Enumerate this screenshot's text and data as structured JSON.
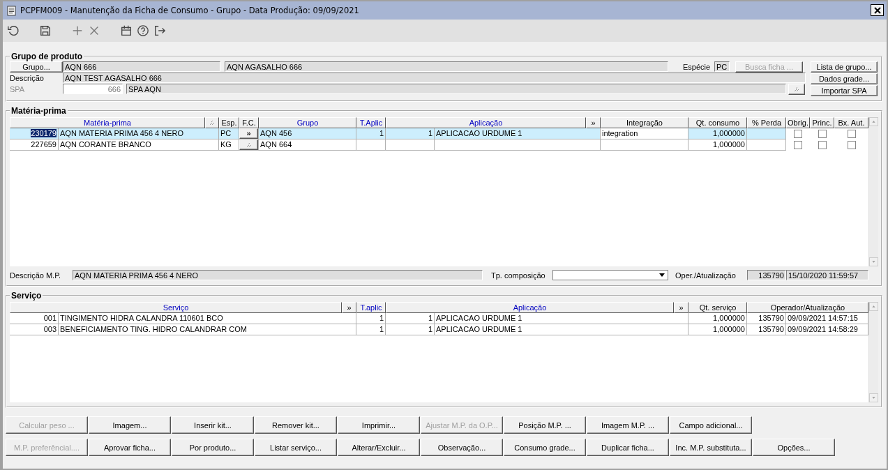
{
  "window": {
    "title": "PCPFM009 - Manutenção da Ficha de Consumo - Grupo - Data Produção: 09/09/2021"
  },
  "product_group": {
    "title": "Grupo de produto",
    "group_button": "Grupo...",
    "group_code": "AQN 666",
    "group_name": "AQN AGASALHO 666",
    "species_label": "Espécie",
    "species": "PC",
    "search_button": {
      "label": "Busca ficha ...",
      "disabled": true
    },
    "description_label": "Descrição",
    "description": "AQN TEST AGASALHO 666",
    "spa_label": {
      "label": "SPA",
      "disabled": true
    },
    "spa_code": "666",
    "spa_name": "SPA AQN",
    "buttons": [
      "Lista de grupo...",
      "Dados grade...",
      "Importar SPA"
    ]
  },
  "raw_materials": {
    "title": "Matéria-prima",
    "headers": [
      {
        "kind": "text",
        "label": "Matéria-prima",
        "linked": true
      },
      {
        "kind": "icon"
      },
      {
        "kind": "text",
        "label": "Esp.",
        "linked": false
      },
      {
        "kind": "text",
        "label": "F.C.",
        "linked": false
      },
      {
        "kind": "text",
        "label": "Grupo",
        "linked": true
      },
      {
        "kind": "text",
        "label": "T.Aplic",
        "linked": true
      },
      {
        "kind": "text",
        "label": "Aplicação",
        "linked": true
      },
      {
        "kind": "text",
        "label": "»",
        "linked": false
      },
      {
        "kind": "text",
        "label": "Integração",
        "linked": false
      },
      {
        "kind": "text",
        "label": "Qt. consumo",
        "linked": false
      },
      {
        "kind": "text",
        "label": "% Perda",
        "linked": false
      },
      {
        "kind": "text",
        "label": "Obrig.",
        "linked": false
      },
      {
        "kind": "text",
        "label": "Princ.",
        "linked": false
      },
      {
        "kind": "text",
        "label": "Bx. Aut.",
        "linked": false
      }
    ],
    "rows": [
      {
        "selected": true,
        "code": "230179",
        "name": "AQN MATERIA PRIMA 456 4 NERO",
        "species": "PC",
        "fc": {
          "kind": "text",
          "label": "»"
        },
        "group": "AQN 456",
        "t_aplic": "1",
        "aplic_qty": "1",
        "aplic": "APLICACAO URDUME 1",
        "integration": "integration",
        "qty": "1,000000",
        "obrig": false,
        "princ": false,
        "bx_aut": false
      },
      {
        "selected": false,
        "code": "227659",
        "name": "AQN CORANTE BRANCO",
        "species": "KG",
        "fc": {
          "kind": "icon"
        },
        "group": "AQN 664",
        "qty": "1,000000",
        "obrig": false,
        "princ": false,
        "bx_aut": false
      }
    ],
    "description_label": "Descrição M.P.",
    "description": "AQN MATERIA PRIMA 456 4 NERO",
    "composition_label": "Tp. composição",
    "operator_label": "Oper./Atualização",
    "operator": "135790",
    "updated": "15/10/2020 11:59:57"
  },
  "services": {
    "title": "Serviço",
    "headers": [
      {
        "label": "Serviço",
        "linked": true
      },
      {
        "label": "»",
        "linked": false
      },
      {
        "label": "T.aplic",
        "linked": true
      },
      {
        "label": "Aplicação",
        "linked": true
      },
      {
        "label": "»",
        "linked": false
      },
      {
        "label": "Qt. serviço",
        "linked": false
      },
      {
        "label": "Operador/Atualização",
        "linked": false
      }
    ],
    "rows": [
      {
        "code": "001",
        "name": "TINGIMENTO HIDRA CALANDRA 110601 BCO",
        "t_aplic": "1",
        "aplic_qty": "1",
        "aplic": "APLICACAO URDUME 1",
        "qty": "1,000000",
        "operator": "135790",
        "updated": "09/09/2021 14:57:15"
      },
      {
        "code": "003",
        "name": "BENEFICIAMENTO TING. HIDRO CALANDRAR COM",
        "t_aplic": "1",
        "aplic_qty": "1",
        "aplic": "APLICACAO URDUME 1",
        "qty": "1,000000",
        "operator": "135790",
        "updated": "09/09/2021 14:58:29"
      }
    ]
  },
  "buttons": [
    [
      {
        "label": "Calcular peso ...",
        "disabled": true
      },
      {
        "label": "Imagem...",
        "disabled": false
      },
      {
        "label": "Inserir kit...",
        "disabled": false
      },
      {
        "label": "Remover kit...",
        "disabled": false
      },
      {
        "label": "Imprimir...",
        "disabled": false
      },
      {
        "label": "Ajustar M.P. da O.P...",
        "disabled": true
      },
      {
        "label": "Posição M.P. ...",
        "disabled": false
      },
      {
        "label": "Imagem M.P. ...",
        "disabled": false
      },
      {
        "label": "Campo adicional...",
        "disabled": false
      }
    ],
    [
      {
        "label": "M.P. preferêncial....",
        "disabled": true
      },
      {
        "label": "Aprovar ficha...",
        "disabled": false
      },
      {
        "label": "Por produto...",
        "disabled": false
      },
      {
        "label": "Listar serviço...",
        "disabled": false
      },
      {
        "label": "Alterar/Excluir...",
        "disabled": false
      },
      {
        "label": "Observação...",
        "disabled": false
      },
      {
        "label": "Consumo grade...",
        "disabled": false
      },
      {
        "label": "Duplicar ficha...",
        "disabled": false
      },
      {
        "label": "Inc. M.P. substituta...",
        "disabled": false
      },
      {
        "label": "Opções...",
        "disabled": false
      }
    ]
  ]
}
